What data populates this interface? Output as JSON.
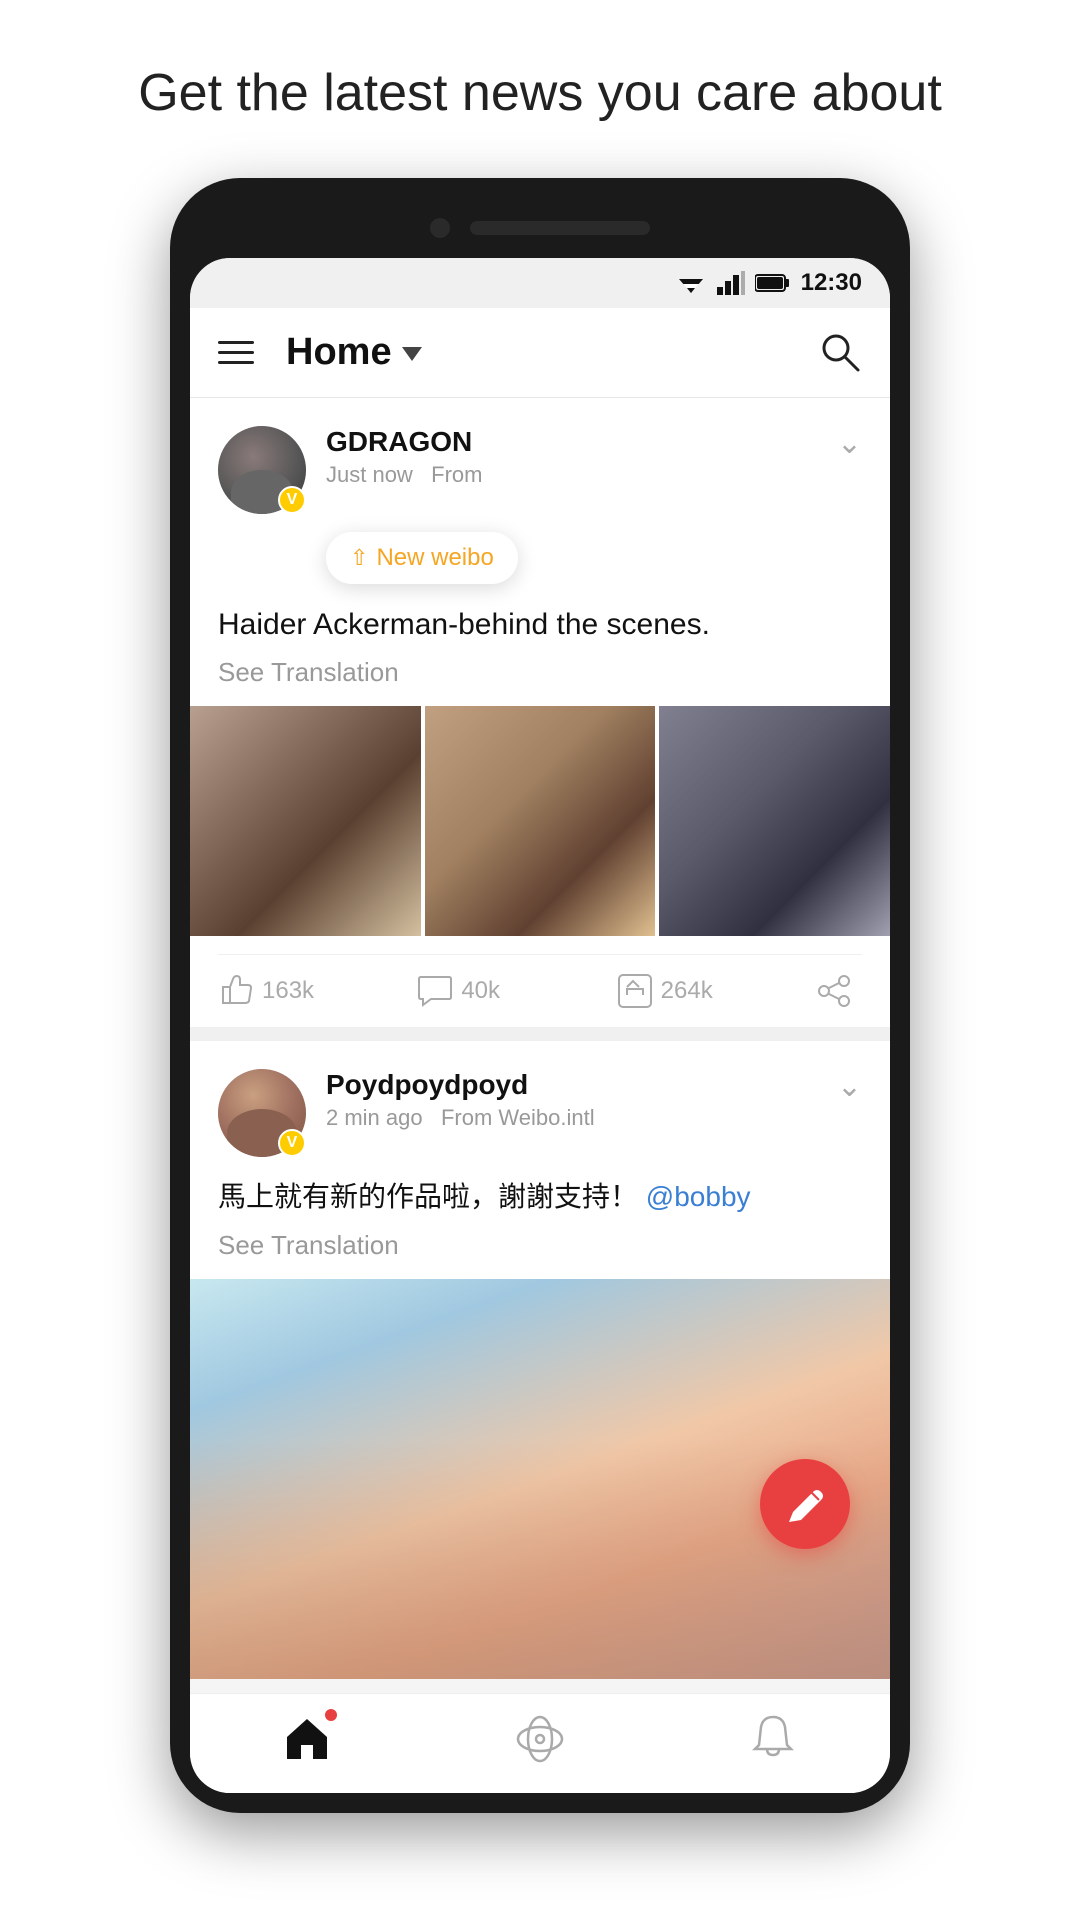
{
  "headline": "Get the latest news you care about",
  "statusBar": {
    "time": "12:30"
  },
  "appBar": {
    "title": "Home",
    "menuLabel": "menu",
    "searchLabel": "search"
  },
  "newWeibo": {
    "label": "New weibo"
  },
  "posts": [
    {
      "username": "GDRAGON",
      "timeAgo": "Just now",
      "source": "From",
      "text": "Haider Ackerman-behind the scenes.",
      "seeTranslation": "See Translation",
      "likes": "163k",
      "comments": "40k",
      "reposts": "264k"
    },
    {
      "username": "Poydpoydpoyd",
      "timeAgo": "2 min ago",
      "source": "From Weibo.intl",
      "text": "馬上就有新的作品啦，謝謝支持！",
      "mention": "@bobby",
      "seeTranslation": "See Translation"
    }
  ],
  "nav": {
    "home": "home",
    "explore": "explore",
    "notifications": "notifications"
  },
  "fab": {
    "label": "compose"
  }
}
